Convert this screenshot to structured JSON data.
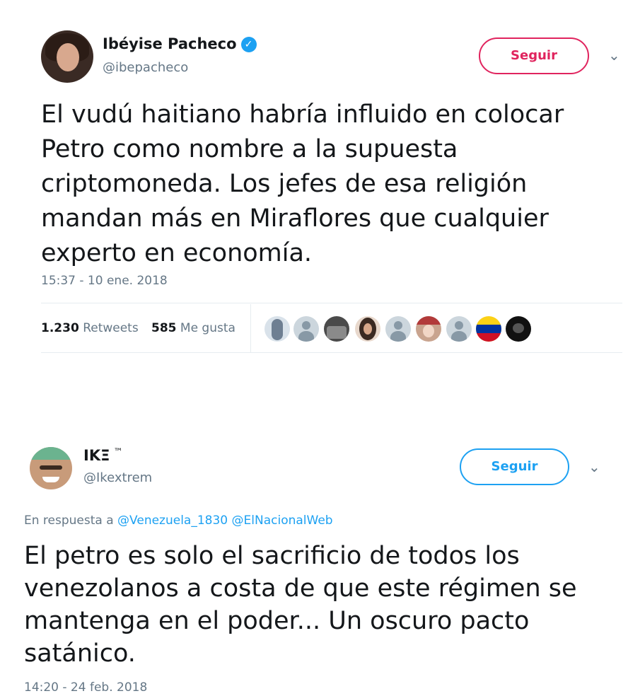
{
  "tweet1": {
    "name": "Ibéyise Pacheco",
    "handle": "@ibepacheco",
    "follow_label": "Seguir",
    "text": "El vudú haitiano habría influido en colocar Petro como nombre a la supuesta criptomoneda. Los jefes de esa religión mandan más en Miraflores que cualquier experto en economía.",
    "timestamp": "15:37 - 10 ene. 2018",
    "retweets_count": "1.230",
    "retweets_label": "Retweets",
    "likes_count": "585",
    "likes_label": "Me gusta",
    "accent_color": "#e0245e"
  },
  "tweet2": {
    "name": "IKΞ",
    "name_suffix": "™",
    "handle": "@Ikextrem",
    "follow_label": "Seguir",
    "reply_prefix": "En respuesta a",
    "reply_mention_1": "@Venezuela_1830",
    "reply_mention_2": "@ElNacionalWeb",
    "text": "El petro es solo el sacrificio de todos los venezolanos a costa de que este régimen se mantenga en el poder... Un oscuro pacto satánico.",
    "timestamp": "14:20 - 24 feb. 2018",
    "accent_color": "#1da1f2"
  },
  "icons": {
    "verified": "✓",
    "chevron": "⌄"
  }
}
